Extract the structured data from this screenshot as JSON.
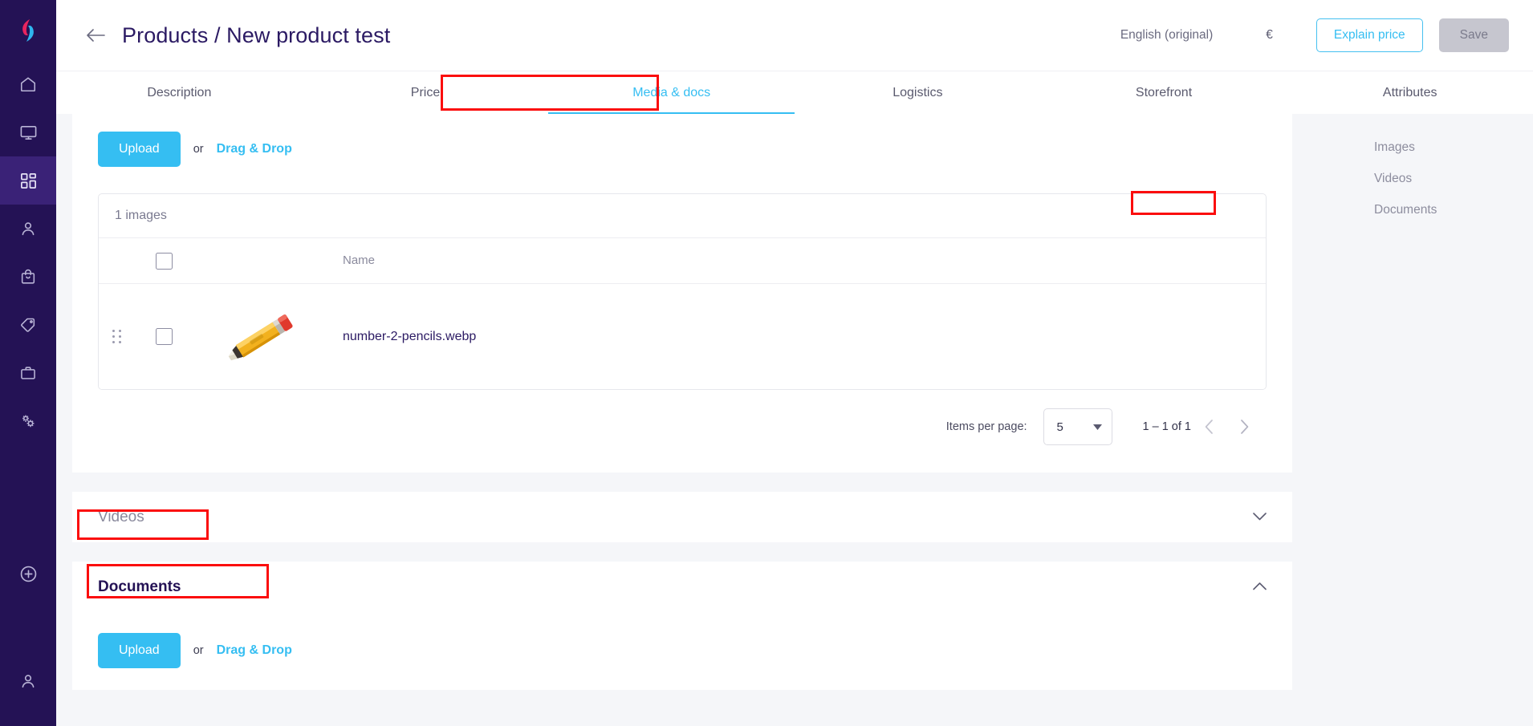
{
  "app": {
    "logo_icon": "brand-swirl-logo",
    "accent_blue": "#35bef2",
    "sidebar_bg": "#241255",
    "highlight_red": "#fb0d0d"
  },
  "left_rail": {
    "items": [
      {
        "icon": "home-icon",
        "name": "home",
        "active": false
      },
      {
        "icon": "monitor-icon",
        "name": "monitor",
        "active": false
      },
      {
        "icon": "grid-icon",
        "name": "catalog",
        "active": true
      },
      {
        "icon": "user-icon",
        "name": "customers",
        "active": false
      },
      {
        "icon": "shopping-bag-icon",
        "name": "orders",
        "active": false
      },
      {
        "icon": "tag-icon",
        "name": "pricing",
        "active": false
      },
      {
        "icon": "briefcase-icon",
        "name": "business",
        "active": false
      },
      {
        "icon": "gears-icon",
        "name": "settings",
        "active": false
      }
    ],
    "add_icon": "plus-circle-icon",
    "account_icon": "user-account-icon"
  },
  "header": {
    "back_icon": "arrow-left-icon",
    "title": "Products / New product test",
    "language": "English (original)",
    "currency": "€",
    "explain_price_label": "Explain price",
    "save_label": "Save"
  },
  "tabs": [
    {
      "label": "Description",
      "active": false
    },
    {
      "label": "Price",
      "active": false
    },
    {
      "label": "Media & docs",
      "active": true
    },
    {
      "label": "Logistics",
      "active": false
    },
    {
      "label": "Storefront",
      "active": false
    },
    {
      "label": "Attributes",
      "active": false
    }
  ],
  "images_section": {
    "upload_label": "Upload",
    "or_label": "or",
    "drag_drop_label": "Drag & Drop",
    "table_caption": "1 images",
    "columns": [
      "Name"
    ],
    "rows": [
      {
        "thumb_icon": "pencil-image",
        "name": "number-2-pencils.webp"
      }
    ],
    "paginator": {
      "items_per_page_label": "Items per page:",
      "items_per_page_value": "5",
      "range_label": "1 – 1 of 1",
      "prev_icon": "chevron-left-icon",
      "next_icon": "chevron-right-icon",
      "dropdown_icon": "caret-down-icon"
    }
  },
  "videos_section": {
    "title": "Videos",
    "chevron_icon": "chevron-down-icon"
  },
  "documents_section": {
    "title": "Documents",
    "chevron_icon": "chevron-up-icon",
    "upload_label": "Upload",
    "or_label": "or",
    "drag_drop_label": "Drag & Drop"
  },
  "right_nav": {
    "items": [
      {
        "label": "Images",
        "highlighted": false
      },
      {
        "label": "Videos",
        "highlighted": false
      },
      {
        "label": "Documents",
        "highlighted": true
      }
    ]
  }
}
